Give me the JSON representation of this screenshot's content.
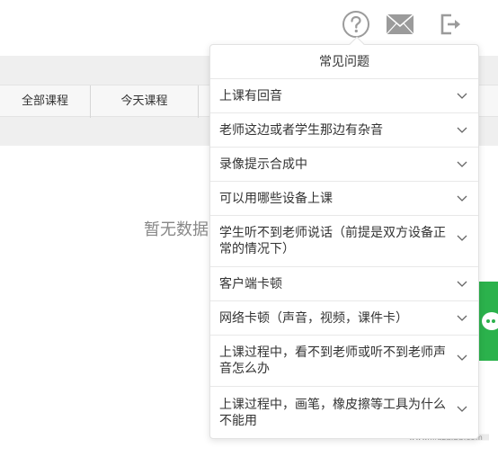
{
  "toolbar": {
    "help_icon": "question-circle-icon",
    "mail_icon": "envelope-icon",
    "exit_icon": "logout-icon"
  },
  "tabs": [
    {
      "label": "全部课程"
    },
    {
      "label": "今天课程"
    }
  ],
  "main": {
    "empty_text": "暂无数据"
  },
  "faq": {
    "title": "常见问题",
    "items": [
      {
        "label": "上课有回音"
      },
      {
        "label": "老师这边或者学生那边有杂音"
      },
      {
        "label": "录像提示合成中"
      },
      {
        "label": "可以用哪些设备上课"
      },
      {
        "label": "学生听不到老师说话（前提是双方设备正常的情况下）"
      },
      {
        "label": "客户端卡顿"
      },
      {
        "label": "网络卡顿（声音，视频，课件卡）"
      },
      {
        "label": "上课过程中，看不到老师或听不到老师声音怎么办"
      },
      {
        "label": "上课过程中，画笔，橡皮擦等工具为什么不能用"
      }
    ]
  },
  "watermark": {
    "text": "www.xiazaiba.com"
  },
  "colors": {
    "accent_green": "#2bb24c",
    "band_gray": "#efefef",
    "icon_gray": "#9b9b9b"
  }
}
